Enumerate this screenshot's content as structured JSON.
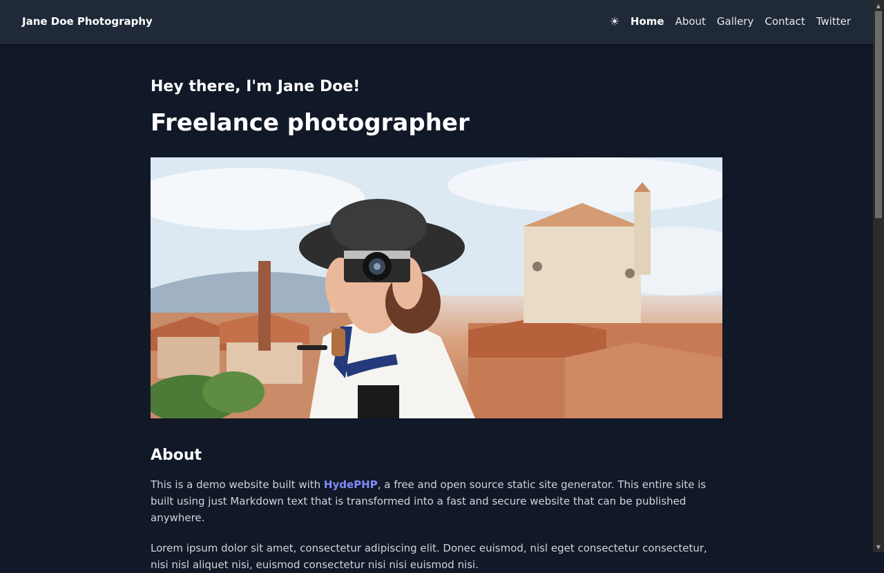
{
  "nav": {
    "brand": "Jane Doe Photography",
    "theme_icon": "sun-icon",
    "links": [
      {
        "label": "Home",
        "active": true
      },
      {
        "label": "About"
      },
      {
        "label": "Gallery"
      },
      {
        "label": "Contact"
      },
      {
        "label": "Twitter"
      }
    ]
  },
  "hero": {
    "greeting": "Hey there, I'm Jane Doe!",
    "title": "Freelance photographer"
  },
  "about": {
    "heading": "About",
    "p1_before": "This is a demo website built with ",
    "p1_link": "HydePHP",
    "p1_after": ", a free and open source static site generator. This entire site is built using just Markdown text that is transformed into a fast and secure website that can be published anywhere.",
    "p2": "Lorem ipsum dolor sit amet, consectetur adipiscing elit. Donec euismod, nisl eget consectetur consectetur, nisi nisl aliquet nisi, euismod consectetur nisi nisi euismod nisi."
  },
  "colors": {
    "background": "#111827",
    "navbar": "#1f2937",
    "link": "#818cf8"
  }
}
